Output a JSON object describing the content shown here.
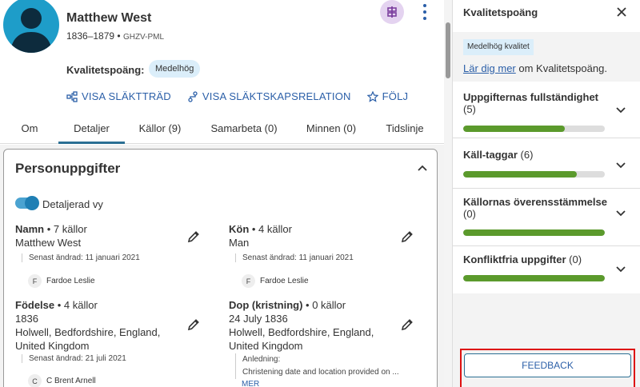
{
  "person": {
    "name": "Matthew West",
    "lifespan": "1836–1879 •",
    "pid": "GHZV-PML",
    "quality_label": "Kvalitetspoäng:",
    "quality_badge": "Medelhög"
  },
  "actions": [
    {
      "label": "VISA SLÄKTTRÄD",
      "icon": "tree-icon"
    },
    {
      "label": "VISA SLÄKTSKAPSRELATION",
      "icon": "relationship-icon"
    },
    {
      "label": "FÖLJ",
      "icon": "star-icon"
    }
  ],
  "tabs": [
    "Om",
    "Detaljer",
    "Källor (9)",
    "Samarbeta (0)",
    "Minnen (0)",
    "Tidslinje"
  ],
  "active_tab": "Detaljer",
  "card": {
    "title": "Personuppgifter",
    "toggle_label": "Detaljerad vy"
  },
  "fields": {
    "name": {
      "label": "Namn",
      "count": " • 7 källor",
      "value": "Matthew West",
      "modified": "Senast ändrad: 11 januari 2021",
      "contrib_initial": "F",
      "contrib_name": "Fardoe Leslie"
    },
    "gender": {
      "label": "Kön",
      "count": " • 4 källor",
      "value": "Man",
      "modified": "Senast ändrad: 11 januari 2021",
      "contrib_initial": "F",
      "contrib_name": "Fardoe Leslie"
    },
    "birth": {
      "label": "Födelse",
      "count": " • 4 källor",
      "value1": "1836",
      "value2": "Holwell, Bedfordshire, England,",
      "value3": "United Kingdom",
      "modified": "Senast ändrad: 21 juli 2021",
      "contrib_initial": "C",
      "contrib_name": "C Brent Arnell"
    },
    "christening": {
      "label": "Dop (kristning)",
      "count": " • 0 källor",
      "value1": "24 July 1836",
      "value2": "Holwell, Bedfordshire, England,",
      "value3": "United Kingdom",
      "reason_label": "Anledning:",
      "reason": "Christening date and location provided on ...",
      "more": "MER"
    }
  },
  "panel": {
    "title": "Kvalitetspoäng",
    "badge": "Medelhög kvalitet",
    "learn_link": "Lär dig mer",
    "learn_rest": " om Kvalitetspoäng.",
    "sections": [
      {
        "title": "Uppgifternas fullständighet",
        "count": "(5)",
        "fill": 0.72
      },
      {
        "title": "Käll-taggar",
        "count": " (6)",
        "fill": 0.8
      },
      {
        "title": "Källornas överensstämmelse",
        "count": "(0)",
        "fill": 1.0
      },
      {
        "title": "Konfliktfria uppgifter",
        "count": " (0)",
        "fill": 1.0
      }
    ],
    "feedback": "FEEDBACK"
  },
  "colors": {
    "accent": "#2b5fa8",
    "bar_fill": "#5b9a2c",
    "badge_bg": "#dbeefa",
    "highlight_frame": "#dd1111"
  }
}
